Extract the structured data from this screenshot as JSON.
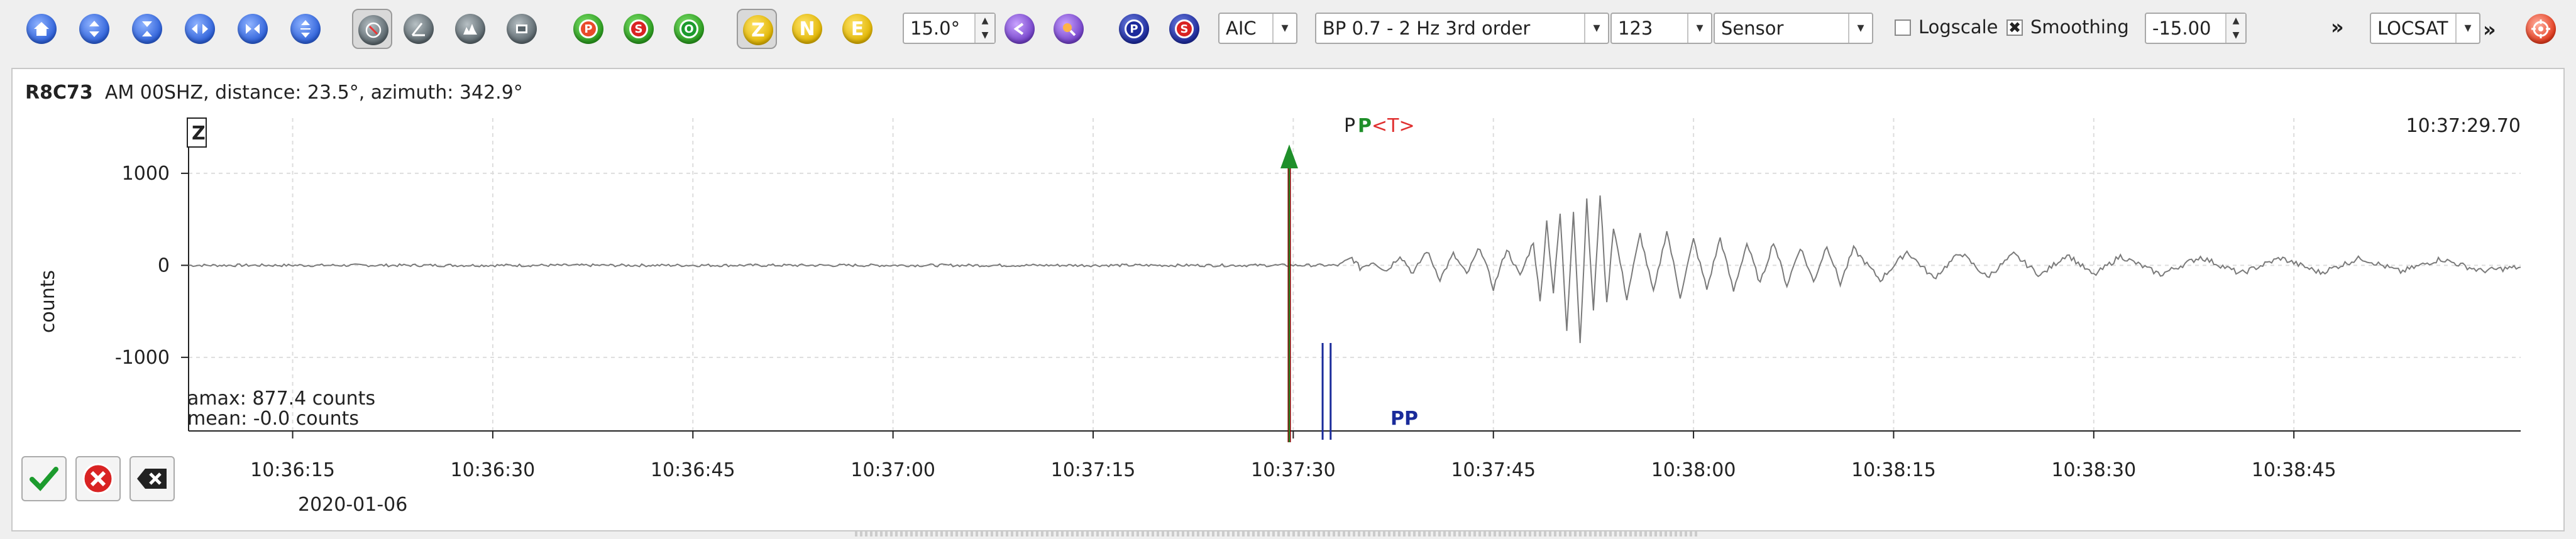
{
  "toolbar": {
    "filter_dist": "15.0°",
    "picker_method": "AIC",
    "filter": "BP 0.7 - 2 Hz  3rd order",
    "channel_order": "123",
    "unit_mode": "Sensor",
    "logscale_label": "Logscale",
    "logscale_checked": false,
    "smoothing_label": "Smoothing",
    "smoothing_checked": true,
    "offset_value": "-15.00",
    "locator": "LOCSAT",
    "more_1": "»",
    "more_2": "»",
    "component_buttons": [
      "Z",
      "N",
      "E"
    ],
    "phase_buttons": [
      "P",
      "S"
    ],
    "pick_buttons": [
      "P",
      "S",
      "O"
    ]
  },
  "trace": {
    "station": "R8C73",
    "details": "AM  00SHZ, distance: 23.5°, azimuth: 342.9°",
    "component": "Z",
    "time_label": "10:37:29.70",
    "ylabel": "counts",
    "amax": "amax: 877.4 counts",
    "mean": "mean: -0.0 counts",
    "date": "2020-01-06",
    "picks": {
      "p_theoretical": "P",
      "p_picked": "P",
      "tag": "<T>",
      "pp_label": "PP",
      "pp_alt": "pP"
    }
  },
  "colors": {
    "pick_red": "#8b0000",
    "pick_green": "#1f8f2a",
    "phase_blue": "#1a2b9a",
    "trace": "#7a7a7a"
  },
  "chart_data": {
    "type": "line",
    "ylabel": "counts",
    "ylim": [
      -1800,
      1600
    ],
    "yticks": [
      1000,
      0,
      -1000
    ],
    "ytick_labels": [
      "1000",
      "0",
      "-1000"
    ],
    "xtick_labels": [
      "10:36:15",
      "10:36:30",
      "10:36:45",
      "10:37:00",
      "10:37:15",
      "10:37:30",
      "10:37:45",
      "10:38:00",
      "10:38:15",
      "10:38:30",
      "10:38:45"
    ],
    "xlim_seconds_after_10_36": [
      7.2,
      182.0
    ],
    "grid": true,
    "series": [
      {
        "points": [
          [
            7.2,
            0
          ],
          [
            30,
            0
          ],
          [
            60,
            0
          ],
          [
            90,
            0
          ],
          [
            93.5,
            0
          ],
          [
            94.4,
            80
          ],
          [
            95,
            -30
          ],
          [
            96,
            40
          ],
          [
            97,
            -60
          ],
          [
            98,
            110
          ],
          [
            99,
            -90
          ],
          [
            100,
            160
          ],
          [
            101,
            -150
          ],
          [
            102,
            120
          ],
          [
            103,
            -100
          ],
          [
            104,
            200
          ],
          [
            105,
            -250
          ],
          [
            106,
            180
          ],
          [
            107,
            -120
          ],
          [
            108,
            260
          ],
          [
            108.5,
            -400
          ],
          [
            109,
            480
          ],
          [
            109.5,
            -300
          ],
          [
            110,
            560
          ],
          [
            110.5,
            -700
          ],
          [
            111,
            600
          ],
          [
            111.5,
            -850
          ],
          [
            112,
            700
          ],
          [
            112.5,
            -500
          ],
          [
            113,
            780
          ],
          [
            113.5,
            -420
          ],
          [
            114,
            420
          ],
          [
            115,
            -360
          ],
          [
            116,
            340
          ],
          [
            117,
            -300
          ],
          [
            118,
            380
          ],
          [
            119,
            -340
          ],
          [
            120,
            280
          ],
          [
            121,
            -260
          ],
          [
            122,
            300
          ],
          [
            123,
            -280
          ],
          [
            124,
            240
          ],
          [
            125,
            -200
          ],
          [
            126,
            260
          ],
          [
            127,
            -220
          ],
          [
            128,
            200
          ],
          [
            129,
            -180
          ],
          [
            130,
            220
          ],
          [
            131,
            -200
          ],
          [
            132,
            180
          ],
          [
            134,
            -160
          ],
          [
            136,
            150
          ],
          [
            138,
            -140
          ],
          [
            140,
            140
          ],
          [
            142,
            -130
          ],
          [
            144,
            120
          ],
          [
            146,
            -110
          ],
          [
            148,
            120
          ],
          [
            150,
            -110
          ],
          [
            152,
            100
          ],
          [
            155,
            -100
          ],
          [
            158,
            90
          ],
          [
            161,
            -90
          ],
          [
            164,
            80
          ],
          [
            167,
            -80
          ],
          [
            170,
            80
          ],
          [
            173,
            -70
          ],
          [
            176,
            70
          ],
          [
            179,
            -60
          ],
          [
            182,
            -20
          ]
        ]
      }
    ]
  }
}
